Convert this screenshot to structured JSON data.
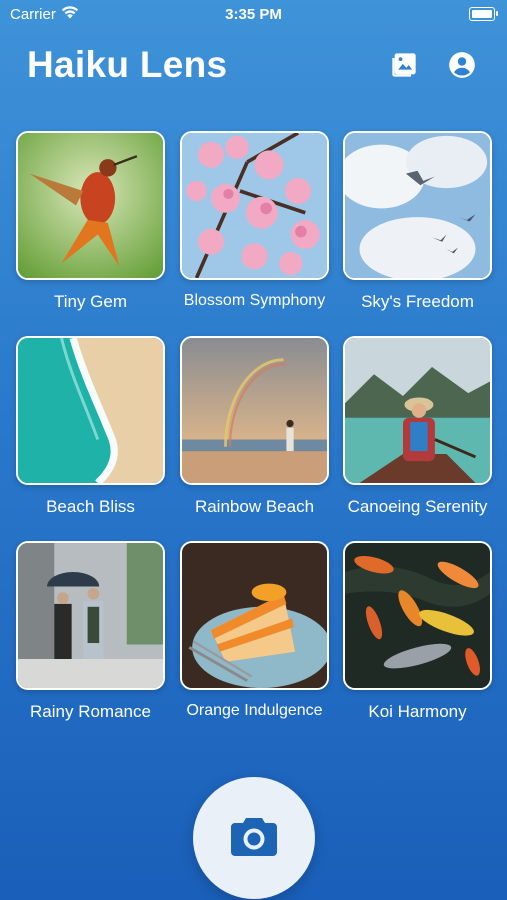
{
  "status": {
    "carrier": "Carrier",
    "time": "3:35 PM"
  },
  "header": {
    "title": "Haiku Lens",
    "gallery_icon": "photo-gallery-icon",
    "profile_icon": "account-circle-icon"
  },
  "photos": [
    {
      "caption": "Tiny Gem"
    },
    {
      "caption": "Blossom Symphony"
    },
    {
      "caption": "Sky's Freedom"
    },
    {
      "caption": "Beach Bliss"
    },
    {
      "caption": "Rainbow Beach"
    },
    {
      "caption": "Canoeing Serenity"
    },
    {
      "caption": "Rainy Romance"
    },
    {
      "caption": "Orange Indulgence"
    },
    {
      "caption": "Koi Harmony"
    }
  ],
  "camera": {
    "icon": "camera-icon"
  },
  "colors": {
    "accent": "#1d64b4",
    "background_top": "#3f93d8",
    "background_bottom": "#1a5fb9"
  }
}
